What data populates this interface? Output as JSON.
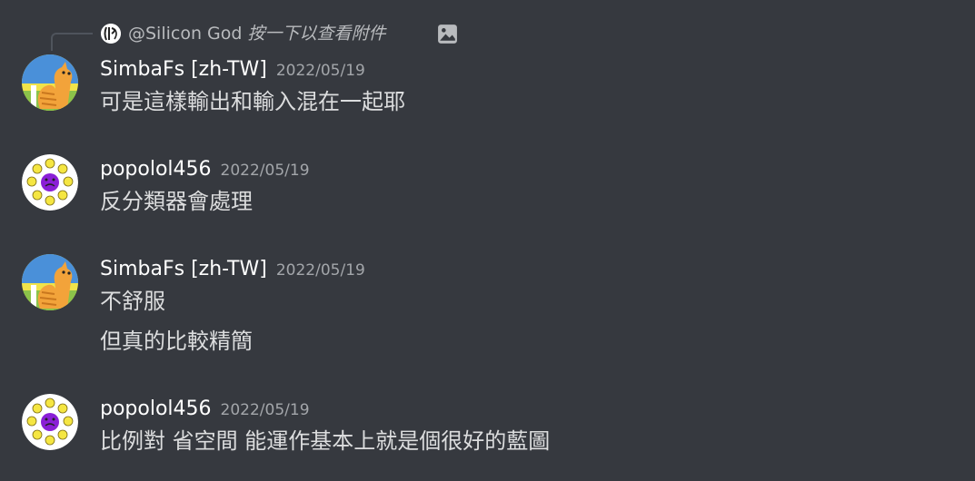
{
  "reply": {
    "mention": "@Silicon God",
    "hint": "按一下以查看附件"
  },
  "messages": [
    {
      "username": "SimbaFs [zh-TW]",
      "timestamp": "2022/05/19",
      "lines": [
        "可是這樣輸出和輸入混在一起耶"
      ]
    },
    {
      "username": "popolol456",
      "timestamp": "2022/05/19",
      "lines": [
        "反分類器會處理"
      ]
    },
    {
      "username": "SimbaFs [zh-TW]",
      "timestamp": "2022/05/19",
      "lines": [
        "不舒服",
        "但真的比較精簡"
      ]
    },
    {
      "username": "popolol456",
      "timestamp": "2022/05/19",
      "lines": [
        "比例對 省空間 能運作基本上就是個很好的藍圖"
      ]
    }
  ],
  "colors": {
    "background": "#36393f",
    "username": "#ffffff",
    "timestamp": "#a3a6aa",
    "message_text": "#dcddde",
    "reply_text": "#b9bbbe"
  }
}
